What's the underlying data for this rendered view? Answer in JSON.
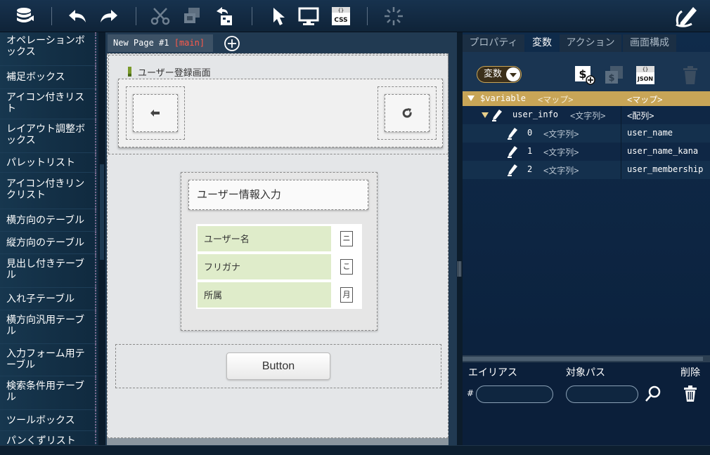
{
  "toolbar": {
    "icons": [
      "database-icon",
      "undo-icon",
      "redo-icon",
      "cut-icon",
      "copy-icon",
      "paste-icon",
      "select-arrow-icon",
      "monitor-icon",
      "css-icon",
      "spinner-icon",
      "edit-pen-icon"
    ],
    "css_label": "CSS"
  },
  "palette": {
    "items": [
      "オペレーションボックス",
      "補足ボックス",
      "アイコン付きリスト",
      "レイアウト調整ボックス",
      "パレットリスト",
      "アイコン付きリンクリスト",
      "横方向のテーブル",
      "縦方向のテーブル",
      "見出し付きテーブル",
      "入れ子テーブル",
      "横方向汎用テーブル",
      "入力フォーム用テーブル",
      "検索条件用テーブル",
      "ツールボックス",
      "パンくずリスト"
    ]
  },
  "canvas": {
    "tab_label": "New Page #1",
    "tab_badge": "[main]",
    "page_title": "ユーザー登録画面",
    "form_title": "ユーザー情報入力",
    "rows": [
      {
        "label": "ユーザー名",
        "field": "ニ"
      },
      {
        "label": "フリガナ",
        "field": "こ"
      },
      {
        "label": "所属",
        "field": "月"
      }
    ],
    "button_label": "Button"
  },
  "right_panel": {
    "tabs": [
      "プロパティ",
      "変数",
      "アクション",
      "画面構成"
    ],
    "active_tab": 1,
    "dropdown_label": "変数",
    "json_label": "JSON",
    "tree": {
      "root": {
        "name": "$variable",
        "type": "<マップ>",
        "value": "<マップ>"
      },
      "child": {
        "name": "user_info",
        "type": "<文字列>",
        "value": "<配列>"
      },
      "items": [
        {
          "index": "0",
          "type": "<文字列>",
          "value": "user_name"
        },
        {
          "index": "1",
          "type": "<文字列>",
          "value": "user_name_kana"
        },
        {
          "index": "2",
          "type": "<文字列>",
          "value": "user_membership"
        }
      ]
    },
    "alias": {
      "col_alias": "エイリアス",
      "col_path": "対象パス",
      "col_delete": "削除",
      "hash": "#"
    }
  },
  "colors": {
    "accent_gold": "#c8a557",
    "form_row_green": "#dfecca",
    "tab_badge_red": "#ff5a4a"
  }
}
